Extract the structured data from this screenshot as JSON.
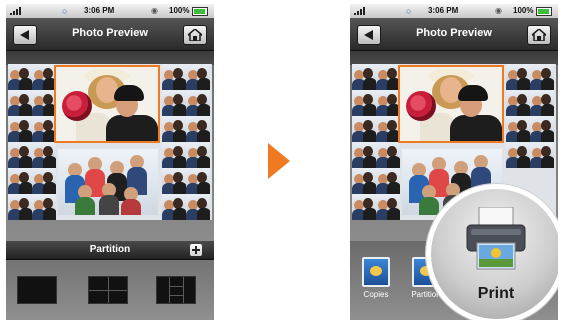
{
  "colors": {
    "accent": "#f07a22",
    "nav_bg": "#3a3a3a",
    "status_bg": "#d8d8d8"
  },
  "status_bar": {
    "time": "3:06 PM",
    "battery": "100%",
    "icons": [
      "signal-icon",
      "wifi-icon",
      "lock-icon",
      "battery-icon"
    ]
  },
  "nav": {
    "title": "Photo Preview",
    "back_icon": "back-arrow-icon",
    "home_icon": "home-icon"
  },
  "left_screen": {
    "partition_title": "Partition",
    "add_icon": "plus-icon",
    "layouts": [
      "single-layout-icon",
      "four-grid-layout-icon",
      "columns-layout-icon"
    ]
  },
  "right_screen": {
    "tools": [
      {
        "label": "Copies",
        "icon": "copies-icon"
      },
      {
        "label": "Partition",
        "icon": "partition-icon"
      }
    ],
    "print_label": "Print",
    "print_icon": "printer-icon"
  },
  "transition_icon": "arrow-right-icon"
}
